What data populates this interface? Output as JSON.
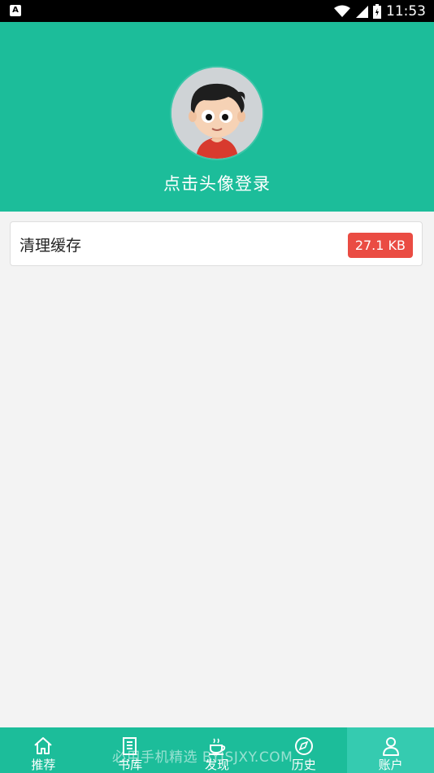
{
  "status_bar": {
    "time": "11:53",
    "left_icon": "A",
    "icons": [
      "wifi-icon",
      "signal-icon",
      "battery-icon"
    ]
  },
  "header": {
    "login_prompt": "点击头像登录",
    "background_color": "#1cbd9a",
    "avatar_icon": "avatar-cartoon-boy-icon"
  },
  "cache": {
    "label": "清理缓存",
    "size": "27.1 KB",
    "badge_color": "#ea4c43"
  },
  "bottom_nav": {
    "items": [
      {
        "label": "推荐",
        "icon": "home-icon"
      },
      {
        "label": "书库",
        "icon": "book-icon"
      },
      {
        "label": "发现",
        "icon": "cup-icon"
      },
      {
        "label": "历史",
        "icon": "compass-icon"
      },
      {
        "label": "账户",
        "icon": "user-icon"
      }
    ],
    "active_index": 4
  },
  "watermark": "必用手机精选  BYJSJXY.COM"
}
